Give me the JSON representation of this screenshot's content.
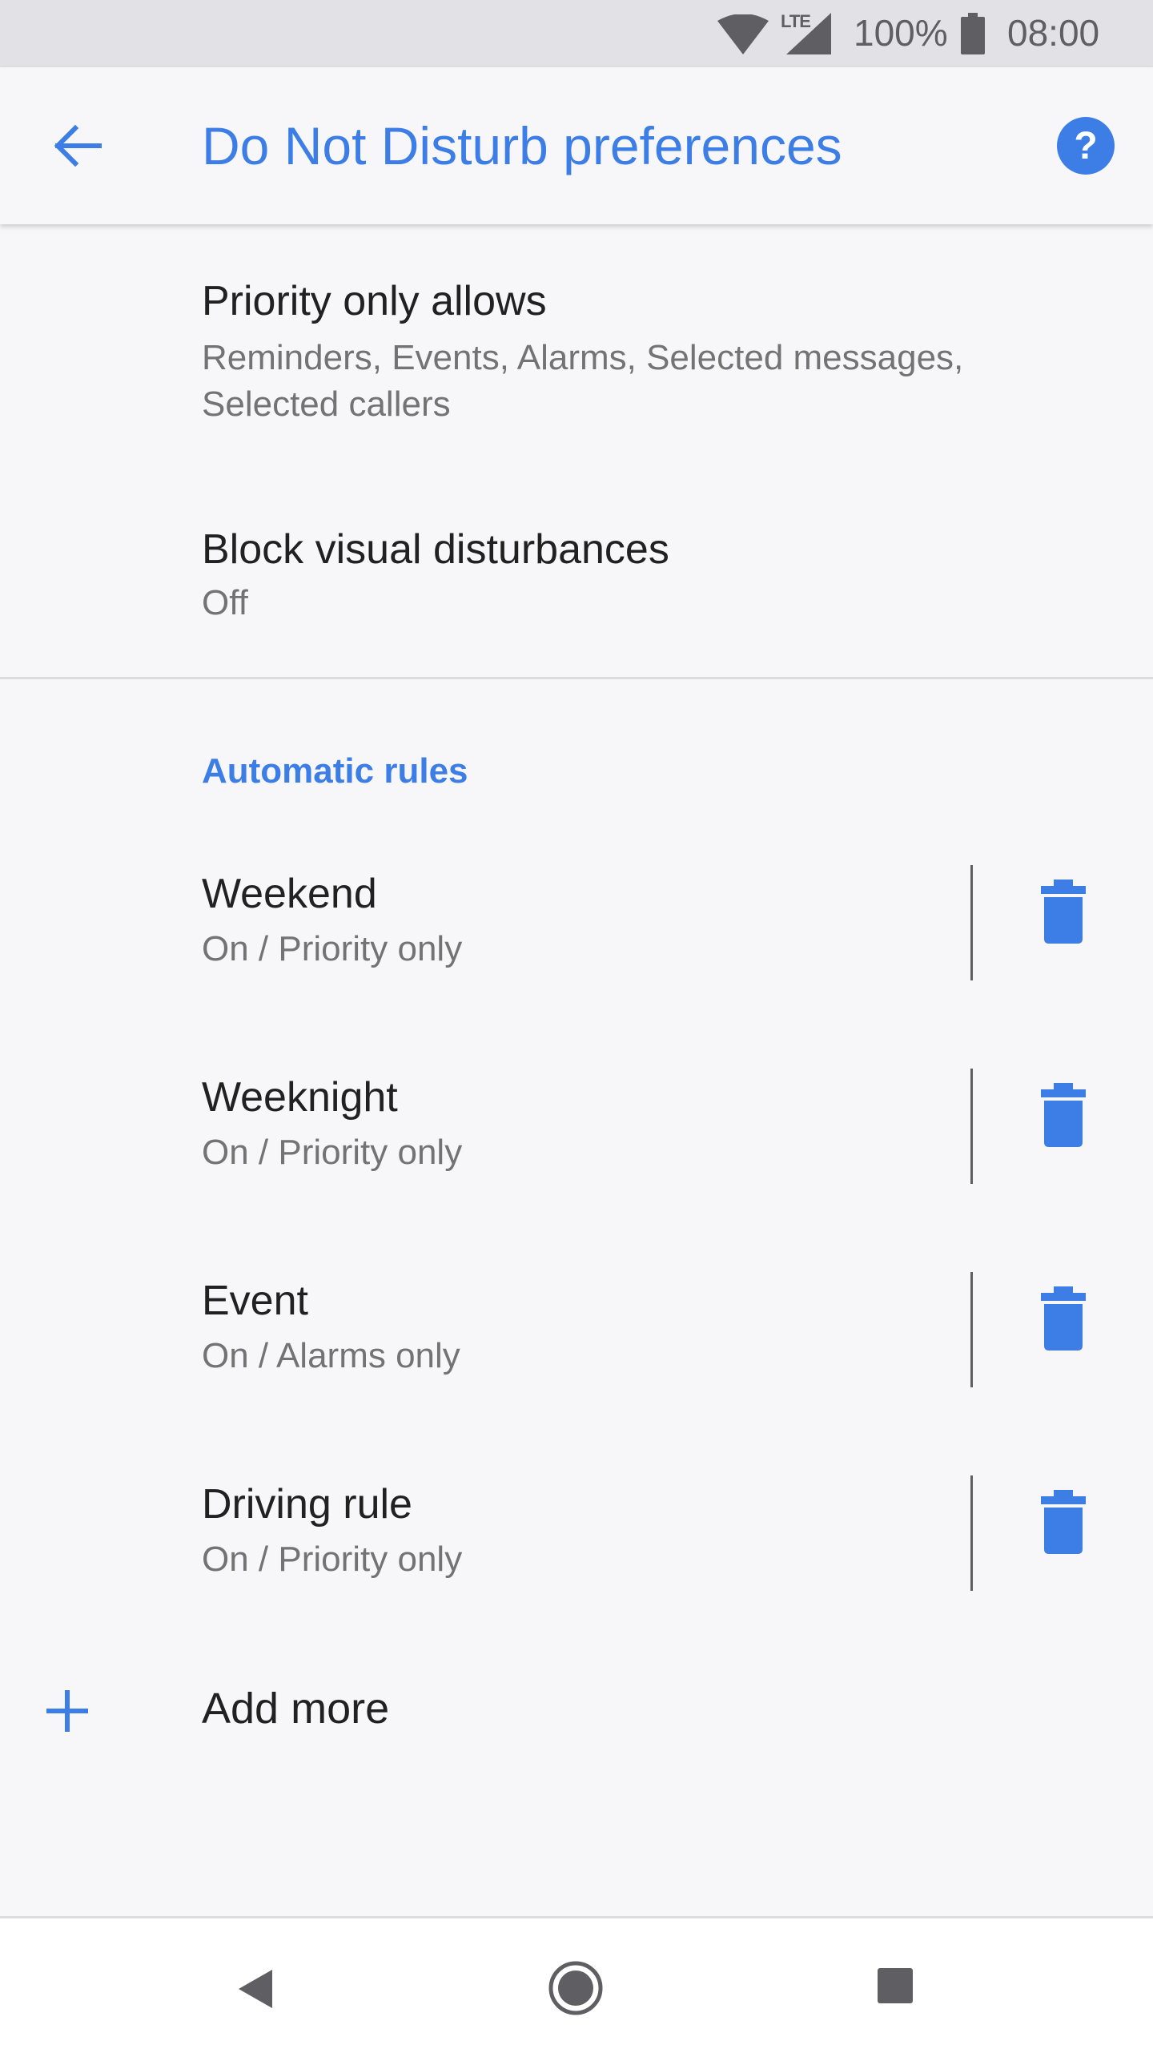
{
  "status_bar": {
    "network_label": "LTE",
    "battery_percent": "100%",
    "time": "08:00",
    "icons": [
      "wifi-icon",
      "cell-signal-icon",
      "battery-icon"
    ]
  },
  "app_bar": {
    "title": "Do Not Disturb preferences",
    "back_icon": "arrow-left-icon",
    "help_icon": "help-circle-icon",
    "accent_color": "#3d7ee6"
  },
  "settings": [
    {
      "title": "Priority only allows",
      "summary": "Reminders, Events, Alarms, Selected messages, Selected callers"
    },
    {
      "title": "Block visual disturbances",
      "summary": "Off"
    }
  ],
  "automatic_rules": {
    "header": "Automatic rules",
    "rules": [
      {
        "name": "Weekend",
        "status": "On / Priority only"
      },
      {
        "name": "Weeknight",
        "status": "On / Priority only"
      },
      {
        "name": "Event",
        "status": "On / Alarms only"
      },
      {
        "name": "Driving rule",
        "status": "On / Priority only"
      }
    ],
    "delete_icon": "trash-icon",
    "add_more_label": "Add more",
    "add_icon": "plus-icon"
  },
  "nav_bar": {
    "icons": [
      "nav-back-icon",
      "nav-home-icon",
      "nav-recents-icon"
    ]
  }
}
